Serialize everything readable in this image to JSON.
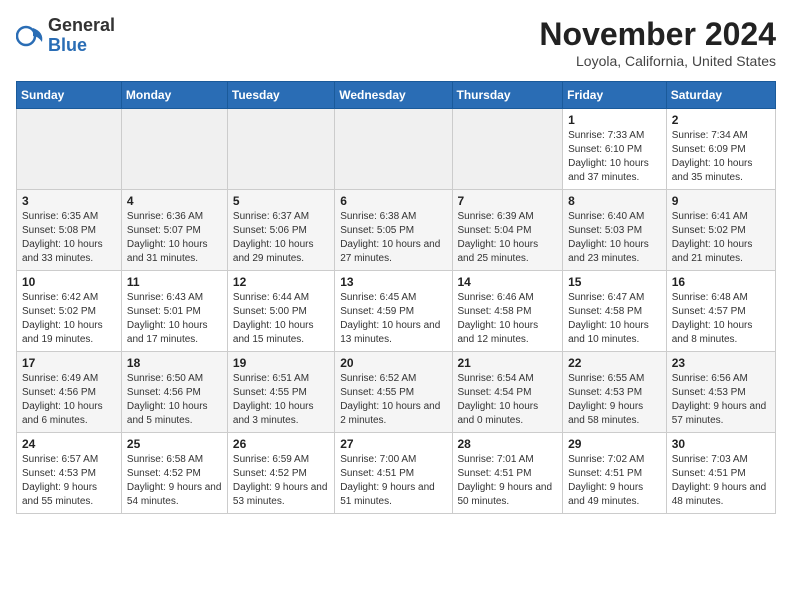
{
  "header": {
    "logo_general": "General",
    "logo_blue": "Blue",
    "month_title": "November 2024",
    "location": "Loyola, California, United States"
  },
  "days_of_week": [
    "Sunday",
    "Monday",
    "Tuesday",
    "Wednesday",
    "Thursday",
    "Friday",
    "Saturday"
  ],
  "weeks": [
    [
      {
        "day": "",
        "info": ""
      },
      {
        "day": "",
        "info": ""
      },
      {
        "day": "",
        "info": ""
      },
      {
        "day": "",
        "info": ""
      },
      {
        "day": "",
        "info": ""
      },
      {
        "day": "1",
        "info": "Sunrise: 7:33 AM\nSunset: 6:10 PM\nDaylight: 10 hours and 37 minutes."
      },
      {
        "day": "2",
        "info": "Sunrise: 7:34 AM\nSunset: 6:09 PM\nDaylight: 10 hours and 35 minutes."
      }
    ],
    [
      {
        "day": "3",
        "info": "Sunrise: 6:35 AM\nSunset: 5:08 PM\nDaylight: 10 hours and 33 minutes."
      },
      {
        "day": "4",
        "info": "Sunrise: 6:36 AM\nSunset: 5:07 PM\nDaylight: 10 hours and 31 minutes."
      },
      {
        "day": "5",
        "info": "Sunrise: 6:37 AM\nSunset: 5:06 PM\nDaylight: 10 hours and 29 minutes."
      },
      {
        "day": "6",
        "info": "Sunrise: 6:38 AM\nSunset: 5:05 PM\nDaylight: 10 hours and 27 minutes."
      },
      {
        "day": "7",
        "info": "Sunrise: 6:39 AM\nSunset: 5:04 PM\nDaylight: 10 hours and 25 minutes."
      },
      {
        "day": "8",
        "info": "Sunrise: 6:40 AM\nSunset: 5:03 PM\nDaylight: 10 hours and 23 minutes."
      },
      {
        "day": "9",
        "info": "Sunrise: 6:41 AM\nSunset: 5:02 PM\nDaylight: 10 hours and 21 minutes."
      }
    ],
    [
      {
        "day": "10",
        "info": "Sunrise: 6:42 AM\nSunset: 5:02 PM\nDaylight: 10 hours and 19 minutes."
      },
      {
        "day": "11",
        "info": "Sunrise: 6:43 AM\nSunset: 5:01 PM\nDaylight: 10 hours and 17 minutes."
      },
      {
        "day": "12",
        "info": "Sunrise: 6:44 AM\nSunset: 5:00 PM\nDaylight: 10 hours and 15 minutes."
      },
      {
        "day": "13",
        "info": "Sunrise: 6:45 AM\nSunset: 4:59 PM\nDaylight: 10 hours and 13 minutes."
      },
      {
        "day": "14",
        "info": "Sunrise: 6:46 AM\nSunset: 4:58 PM\nDaylight: 10 hours and 12 minutes."
      },
      {
        "day": "15",
        "info": "Sunrise: 6:47 AM\nSunset: 4:58 PM\nDaylight: 10 hours and 10 minutes."
      },
      {
        "day": "16",
        "info": "Sunrise: 6:48 AM\nSunset: 4:57 PM\nDaylight: 10 hours and 8 minutes."
      }
    ],
    [
      {
        "day": "17",
        "info": "Sunrise: 6:49 AM\nSunset: 4:56 PM\nDaylight: 10 hours and 6 minutes."
      },
      {
        "day": "18",
        "info": "Sunrise: 6:50 AM\nSunset: 4:56 PM\nDaylight: 10 hours and 5 minutes."
      },
      {
        "day": "19",
        "info": "Sunrise: 6:51 AM\nSunset: 4:55 PM\nDaylight: 10 hours and 3 minutes."
      },
      {
        "day": "20",
        "info": "Sunrise: 6:52 AM\nSunset: 4:55 PM\nDaylight: 10 hours and 2 minutes."
      },
      {
        "day": "21",
        "info": "Sunrise: 6:54 AM\nSunset: 4:54 PM\nDaylight: 10 hours and 0 minutes."
      },
      {
        "day": "22",
        "info": "Sunrise: 6:55 AM\nSunset: 4:53 PM\nDaylight: 9 hours and 58 minutes."
      },
      {
        "day": "23",
        "info": "Sunrise: 6:56 AM\nSunset: 4:53 PM\nDaylight: 9 hours and 57 minutes."
      }
    ],
    [
      {
        "day": "24",
        "info": "Sunrise: 6:57 AM\nSunset: 4:53 PM\nDaylight: 9 hours and 55 minutes."
      },
      {
        "day": "25",
        "info": "Sunrise: 6:58 AM\nSunset: 4:52 PM\nDaylight: 9 hours and 54 minutes."
      },
      {
        "day": "26",
        "info": "Sunrise: 6:59 AM\nSunset: 4:52 PM\nDaylight: 9 hours and 53 minutes."
      },
      {
        "day": "27",
        "info": "Sunrise: 7:00 AM\nSunset: 4:51 PM\nDaylight: 9 hours and 51 minutes."
      },
      {
        "day": "28",
        "info": "Sunrise: 7:01 AM\nSunset: 4:51 PM\nDaylight: 9 hours and 50 minutes."
      },
      {
        "day": "29",
        "info": "Sunrise: 7:02 AM\nSunset: 4:51 PM\nDaylight: 9 hours and 49 minutes."
      },
      {
        "day": "30",
        "info": "Sunrise: 7:03 AM\nSunset: 4:51 PM\nDaylight: 9 hours and 48 minutes."
      }
    ]
  ]
}
